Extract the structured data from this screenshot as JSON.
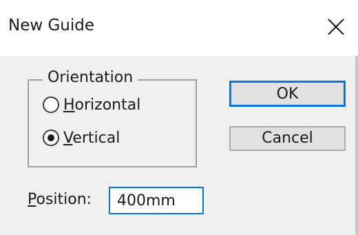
{
  "window": {
    "title": "New Guide",
    "close_icon": "close-icon"
  },
  "orientation": {
    "legend": "Orientation",
    "options": [
      {
        "label_accesskey": "H",
        "label_rest": "orizontal",
        "checked": false
      },
      {
        "label_accesskey": "V",
        "label_rest": "ertical",
        "checked": true
      }
    ]
  },
  "position": {
    "label_accesskey": "P",
    "label_rest": "osition:",
    "value": "400mm"
  },
  "buttons": {
    "ok": "OK",
    "cancel": "Cancel"
  },
  "colors": {
    "accent": "#0078d7",
    "dialog_bg": "#f0f0f0",
    "button_bg": "#e1e1e1"
  }
}
